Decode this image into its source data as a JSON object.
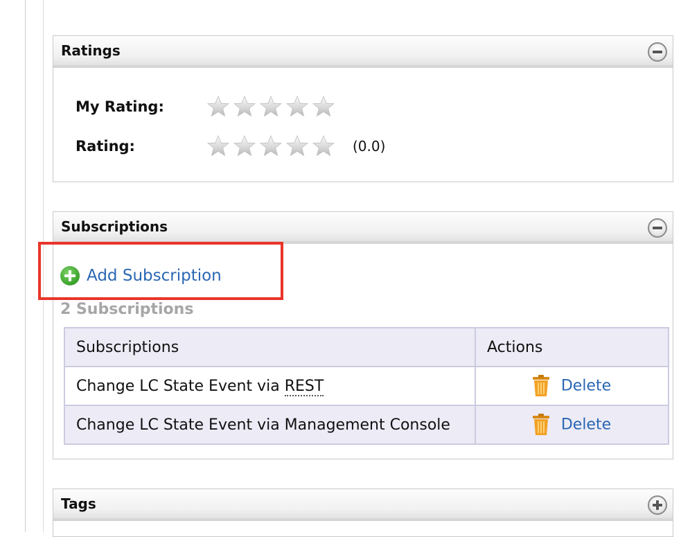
{
  "ratings": {
    "title": "Ratings",
    "my_rating_label": "My Rating:",
    "my_rating_value": 0,
    "rating_label": "Rating:",
    "rating_value": 0,
    "rating_text": "(0.0)",
    "max_stars": 5
  },
  "subscriptions": {
    "title": "Subscriptions",
    "add_label": "Add Subscription",
    "count_text": "2 Subscriptions",
    "table": {
      "headers": [
        "Subscriptions",
        "Actions"
      ],
      "rows": [
        {
          "prefix": "Change LC State Event via ",
          "abbr": "REST",
          "action": "Delete"
        },
        {
          "prefix": "Change LC State Event via Management Console",
          "abbr": "",
          "action": "Delete"
        }
      ]
    }
  },
  "tags": {
    "title": "Tags"
  },
  "colors": {
    "link": "#2a67b3",
    "highlight": "#e8352a",
    "table_header_bg": "#ecebf6"
  }
}
